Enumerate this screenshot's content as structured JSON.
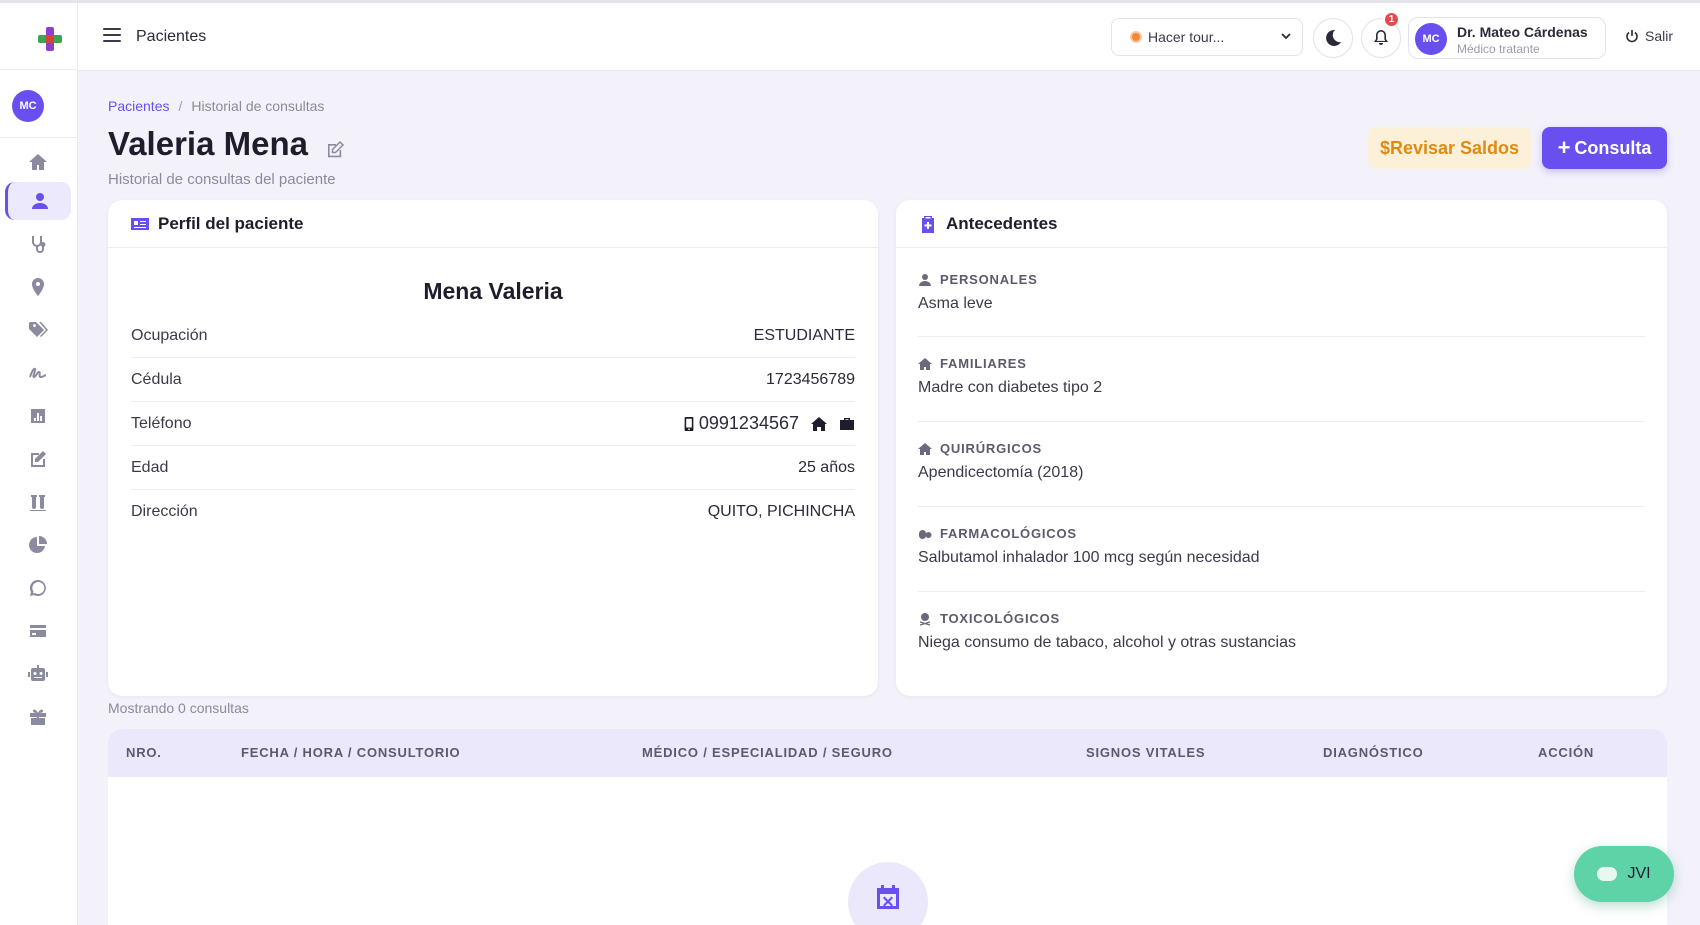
{
  "header": {
    "title": "Pacientes",
    "tour_select": "Hacer tour...",
    "notifications_count": "1",
    "user": {
      "initials": "MC",
      "name": "Dr. Mateo Cárdenas",
      "role": "Médico tratante"
    },
    "logout": "Salir"
  },
  "sidebar": {
    "avatar_initials": "MC",
    "items": [
      {
        "icon": "home-icon"
      },
      {
        "icon": "user-icon",
        "active": true
      },
      {
        "icon": "stethoscope-icon"
      },
      {
        "icon": "map-pin-icon"
      },
      {
        "icon": "tags-icon"
      },
      {
        "icon": "signature-icon"
      },
      {
        "icon": "bar-chart-icon"
      },
      {
        "icon": "edit-icon"
      },
      {
        "icon": "vials-icon"
      },
      {
        "icon": "pie-chart-icon"
      },
      {
        "icon": "whatsapp-icon"
      },
      {
        "icon": "credit-card-icon"
      },
      {
        "icon": "robot-icon"
      },
      {
        "icon": "gift-icon"
      }
    ]
  },
  "breadcrumb": {
    "parent": "Pacientes",
    "current": "Historial de consultas"
  },
  "page": {
    "title": "Valeria Mena",
    "subtitle": "Historial de consultas del paciente",
    "btn_saldos": "Revisar Saldos",
    "btn_consulta": "Consulta"
  },
  "profile": {
    "heading": "Perfil del paciente",
    "full_name": "Mena Valeria",
    "rows": [
      {
        "label": "Ocupación",
        "value": "ESTUDIANTE"
      },
      {
        "label": "Cédula",
        "value": "1723456789"
      },
      {
        "label": "Teléfono",
        "value": "0991234567"
      },
      {
        "label": "Edad",
        "value": "25 años"
      },
      {
        "label": "Dirección",
        "value": "QUITO, PICHINCHA"
      }
    ]
  },
  "antecedentes": {
    "heading": "Antecedentes",
    "sections": [
      {
        "label": "PERSONALES",
        "text": "Asma leve"
      },
      {
        "label": "FAMILIARES",
        "text": "Madre con diabetes tipo 2"
      },
      {
        "label": "QUIRÚRGICOS",
        "text": "Apendicectomía (2018)"
      },
      {
        "label": "FARMACOLÓGICOS",
        "text": "Salbutamol inhalador 100 mcg según necesidad"
      },
      {
        "label": "TOXICOLÓGICOS",
        "text": "Niega consumo de tabaco, alcohol y otras sustancias"
      }
    ]
  },
  "table": {
    "count_text": "Mostrando 0 consultas",
    "columns": [
      "NRO.",
      "FECHA / HORA / CONSULTORIO",
      "MÉDICO / ESPECIALIDAD / SEGURO",
      "SIGNOS VITALES",
      "DIAGNÓSTICO",
      "ACCIÓN"
    ]
  },
  "chat_button": "JVI",
  "colors": {
    "accent": "#6a4ff0",
    "warning_bg": "#fdf0d8",
    "warning_text": "#e08a12",
    "chat": "#5fd3a8",
    "badge": "#e5484d"
  }
}
